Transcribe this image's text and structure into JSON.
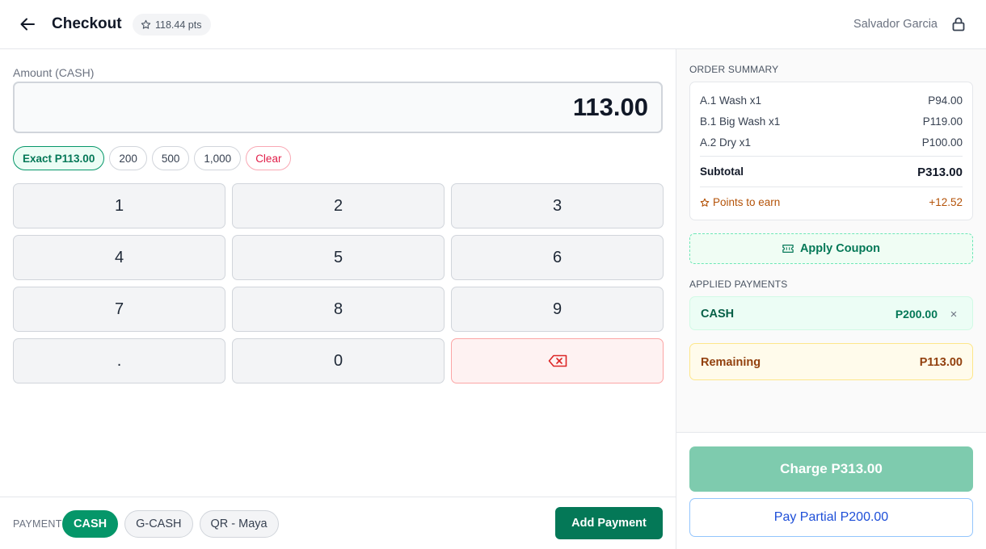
{
  "header": {
    "title": "Checkout",
    "points": "118.44 pts",
    "user_name": "Salvador Garcia",
    "icons": {
      "back": "arrow-left-icon",
      "points": "star-icon",
      "lock": "lock-icon"
    }
  },
  "amount": {
    "label": "Amount (CASH)",
    "value": "113.00"
  },
  "quick_amounts": [
    {
      "label": "Exact P113.00"
    },
    {
      "label": "200"
    },
    {
      "label": "500"
    },
    {
      "label": "1,000"
    },
    {
      "label": "Clear"
    }
  ],
  "keypad": [
    "1",
    "2",
    "3",
    "4",
    "5",
    "6",
    "7",
    "8",
    "9",
    ".",
    "0",
    "⌫"
  ],
  "payment_bar": {
    "label": "PAYMENT",
    "methods": [
      "CASH",
      "G-CASH",
      "QR - Maya"
    ],
    "selected_method": "CASH",
    "add_button": "Add Payment"
  },
  "order_summary": {
    "title": "ORDER SUMMARY",
    "items": [
      {
        "name": "A.1 Wash x1",
        "price": "P94.00"
      },
      {
        "name": "B.1 Big Wash x1",
        "price": "P119.00"
      },
      {
        "name": "A.2 Dry x1",
        "price": "P100.00"
      }
    ],
    "subtotal_label": "Subtotal",
    "subtotal_value": "P313.00",
    "points_label": "Points to earn",
    "points_value": "+12.52"
  },
  "coupon": {
    "label": "Apply Coupon",
    "icon": "ticket-icon"
  },
  "applied_payments": {
    "title": "APPLIED PAYMENTS",
    "items": [
      {
        "method": "CASH",
        "amount": "P200.00",
        "remove": "×"
      }
    ]
  },
  "remaining": {
    "label": "Remaining",
    "value": "P113.00"
  },
  "actions": {
    "charge": "Charge P313.00",
    "partial": "Pay Partial P200.00"
  },
  "colors": {
    "primary_green": "#047857",
    "active_green": "#059669",
    "charge_disabled": "#7ecbae",
    "partial_blue": "#1d4ed8",
    "danger_red": "#e11d48",
    "remaining_amber": "#92400e"
  }
}
